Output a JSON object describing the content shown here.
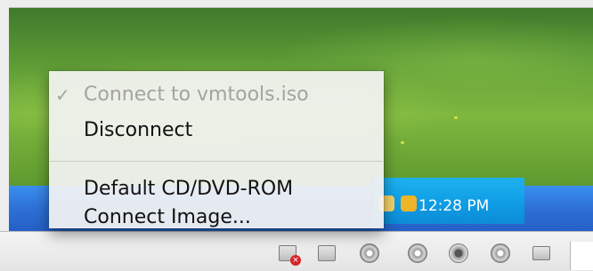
{
  "context_menu": {
    "items": [
      {
        "label": "Connect to vmtools.iso",
        "checked": true,
        "enabled": false
      },
      {
        "label": "Disconnect",
        "checked": false,
        "enabled": true
      },
      {
        "label": "Default CD/DVD-ROM",
        "checked": false,
        "enabled": true
      },
      {
        "label": "Connect Image...",
        "checked": false,
        "enabled": true
      }
    ],
    "check_glyph": "✓"
  },
  "taskbar": {
    "clock": "12:28 PM"
  },
  "status_bar": {
    "icons": [
      "network-disconnected-icon",
      "floppy-icon",
      "cd-dvd-icon",
      "hard-disk-icon",
      "sound-icon",
      "usb-icon",
      "shared-folder-icon"
    ]
  },
  "colors": {
    "taskbar": "#2f72d8",
    "tray": "#109fe6",
    "desktop_green": "#5c9a35",
    "menu_bg": "#f3f3f3"
  }
}
